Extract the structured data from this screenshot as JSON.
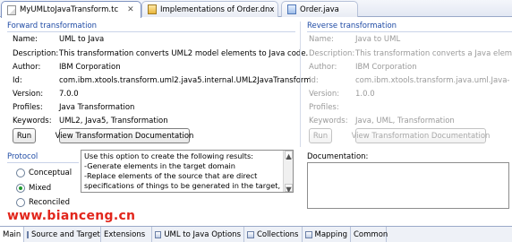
{
  "editor_tabs": [
    {
      "label": "MyUMLtoJavaTransform.tc",
      "active": true
    },
    {
      "label": "Implementations of Order.dnx",
      "active": false
    },
    {
      "label": "Order.java",
      "active": false
    }
  ],
  "forward": {
    "title": "Forward transformation",
    "fields": [
      {
        "label": "Name:",
        "value": "UML to Java"
      },
      {
        "label": "Description:",
        "value": "This transformation converts UML2 model elements to Java code."
      },
      {
        "label": "Author:",
        "value": "IBM Corporation"
      },
      {
        "label": "Id:",
        "value": "com.ibm.xtools.transform.uml2.java5.internal.UML2JavaTransform"
      },
      {
        "label": "Version:",
        "value": "7.0.0"
      },
      {
        "label": "Profiles:",
        "value": "Java Transformation"
      },
      {
        "label": "Keywords:",
        "value": "UML2, Java5, Transformation"
      }
    ],
    "run_label": "Run",
    "doc_label": "View Transformation Documentation"
  },
  "reverse": {
    "title": "Reverse transformation",
    "fields": [
      {
        "label": "Name:",
        "value": "Java to UML"
      },
      {
        "label": "Description:",
        "value": "This transformation converts a Java eleme"
      },
      {
        "label": "Author:",
        "value": "IBM Corporation"
      },
      {
        "label": "Id:",
        "value": "com.ibm.xtools.transform.java.uml.Java-"
      },
      {
        "label": "Version:",
        "value": "1.0.0"
      },
      {
        "label": "Profiles:",
        "value": ""
      },
      {
        "label": "Keywords:",
        "value": "Java, UML, Transformation"
      }
    ],
    "run_label": "Run",
    "doc_label": "View Transformation Documentation"
  },
  "protocol": {
    "title": "Protocol",
    "options": [
      {
        "label": "Conceptual",
        "selected": false
      },
      {
        "label": "Mixed",
        "selected": true
      },
      {
        "label": "Reconciled",
        "selected": false
      }
    ],
    "description_lines": [
      "Use this option to create the following results:",
      "-Generate elements in the target domain",
      "-Replace elements of the source that are direct",
      "specifications of things to be generated in the target,"
    ]
  },
  "documentation": {
    "label": "Documentation:",
    "value": ""
  },
  "page_tabs": [
    {
      "label": "Main",
      "active": true
    },
    {
      "label": "Source and Target",
      "active": false
    },
    {
      "label": "Extensions",
      "active": false
    },
    {
      "label": "UML to Java Options",
      "active": false
    },
    {
      "label": "Collections",
      "active": false
    },
    {
      "label": "Mapping",
      "active": false
    },
    {
      "label": "Common",
      "active": false
    }
  ],
  "watermark": "www.bianceng.cn"
}
